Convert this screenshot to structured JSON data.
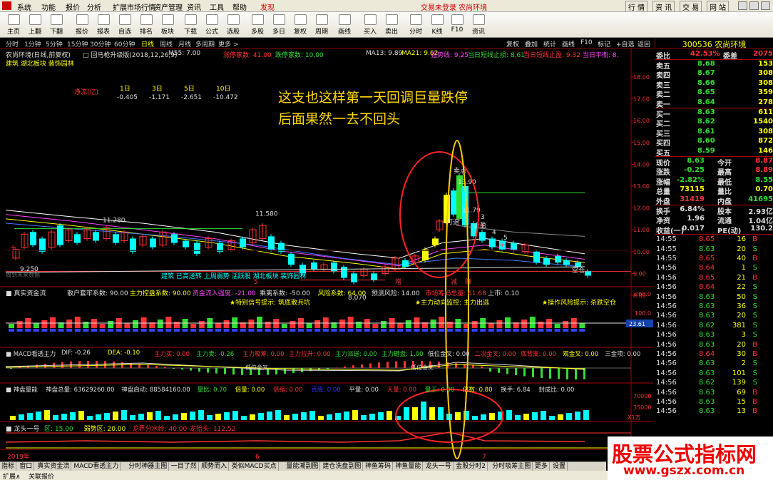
{
  "menu": [
    "系统",
    "功能",
    "报价",
    "分析",
    "扩展市场行情",
    "资产管理",
    "资讯",
    "工具",
    "帮助",
    "发现"
  ],
  "menu_status": "交易未登录  农尚环境",
  "menu_right": [
    "行 情",
    "资 讯",
    "交 易",
    "网 站"
  ],
  "toolbar": [
    {
      "label": "主页",
      "icon": "home-icon"
    },
    {
      "label": "上翻",
      "icon": "up-icon"
    },
    {
      "label": "下翻",
      "icon": "down-icon"
    },
    {
      "label": "报价",
      "icon": "quote-icon"
    },
    {
      "label": "报表",
      "icon": "report-icon"
    },
    {
      "label": "自选",
      "icon": "favorite-icon"
    },
    {
      "label": "排名",
      "icon": "rank-icon"
    },
    {
      "label": "板块",
      "icon": "sector-icon"
    },
    {
      "label": "下载",
      "icon": "download-icon"
    },
    {
      "label": "公式",
      "icon": "formula-icon"
    },
    {
      "label": "选股",
      "icon": "select-icon"
    },
    {
      "label": "多股",
      "icon": "multi-icon"
    },
    {
      "label": "多日",
      "icon": "multiday-icon"
    },
    {
      "label": "复权",
      "icon": "restore-icon"
    },
    {
      "label": "周期",
      "icon": "period-icon"
    },
    {
      "label": "画线",
      "icon": "draw-icon"
    },
    {
      "label": "买入",
      "icon": "buy-icon"
    },
    {
      "label": "卖出",
      "icon": "sell-icon"
    },
    {
      "label": "分时",
      "icon": "minute-icon"
    },
    {
      "label": "K线",
      "icon": "kline-icon"
    },
    {
      "label": "F10",
      "icon": "f10-icon"
    },
    {
      "label": "资讯",
      "icon": "news-icon"
    }
  ],
  "periods": [
    "分时",
    "1分钟",
    "5分钟",
    "15分钟",
    "30分钟",
    "60分钟",
    "日线",
    "周线",
    "月线",
    "多周期",
    "更多 >"
  ],
  "period_right": [
    "复权",
    "叠加",
    "统计",
    "画线",
    "F10",
    "标记",
    "+自选",
    "返回"
  ],
  "stock_code": "300536 农尚环境",
  "header_line1": [
    {
      "t": "农尚环境(日线,前复权)",
      "c": "#ddd"
    },
    {
      "t": "□ 回马枪升级版(2018,12,26,9)",
      "c": "#ddd"
    },
    {
      "t": "M55: 7.00",
      "c": "#ddd"
    },
    {
      "t": "涨停家数: 41.00",
      "c": "#ff3333"
    },
    {
      "t": "跌停家数: 10.00",
      "c": "#33dd33"
    },
    {
      "t": "MA13: 9.89",
      "c": "#ddd"
    },
    {
      "t": "MA21: 9.62",
      "c": "#ffff00"
    },
    {
      "t": "强势线: 9.25",
      "c": "#ff44ff"
    },
    {
      "t": "当日短线止损: 8.61",
      "c": "#33dd33"
    },
    {
      "t": "当日短线止盈: 9.32",
      "c": "#ff3333"
    },
    {
      "t": "当日平衡: 8.",
      "c": "#ff44ff"
    }
  ],
  "header_line2": "建筑 湖北板块 装饰园林",
  "net_flow": {
    "label": "净流(亿)",
    "periods": [
      "1日",
      "3日",
      "5日",
      "10日"
    ],
    "values": [
      "-0.405",
      "-1.171",
      "-2.651",
      "-10.472"
    ]
  },
  "annotation": [
    "这支也这样第一天回调巨量跌停",
    "后面果然一去不回头"
  ],
  "price_axis": [
    "18.00",
    "17.00",
    "16.00",
    "15.00",
    "14.00",
    "13.00",
    "12.00",
    "11.00",
    "10.00",
    "9.00",
    "8.00"
  ],
  "price_labels": {
    "high1": "11.280",
    "high2": "11.580",
    "low1": "9.250",
    "low2": "8.070",
    "peak": "13.90",
    "peak2": "11.79",
    "sell": "卖点",
    "takeprofit": "止盈",
    "ketui": "可退",
    "stoploss": "空仓",
    "num3": "3",
    "num4": "4",
    "num5": "5"
  },
  "sector_text": "建筑 已高送转 上周弱势 活跃股 湖北板块 装饰园林",
  "date_marks": [
    "5",
    "增",
    "减",
    "赚",
    "7"
  ],
  "chart_left_note": "周到末来数据",
  "ind1": {
    "title": "真实资金流",
    "items": [
      {
        "t": "散户套牢系数: 90.00",
        "c": "#ddd"
      },
      {
        "t": "主力控盘系数: 90.00",
        "c": "#ffff00"
      },
      {
        "t": "资金流入强度: -21.00",
        "c": "#ff44ff"
      },
      {
        "t": "乘离系数: -50.00",
        "c": "#ddd"
      },
      {
        "t": "风险系数: 64.00",
        "c": "#ffff00"
      },
      {
        "t": "预测风险: 14.00",
        "c": "#ddd"
      },
      {
        "t": "市场筹码总量: 61.68",
        "c": "#ff3333"
      },
      {
        "t": "上市: 0.10",
        "c": "#ddd"
      }
    ],
    "notes": [
      "★特别信号提示: 筑底散兵坑",
      "★主力动向监控: 主力出逃",
      "★操作风险提示: 杀跌空仓"
    ],
    "axis": [
      "200.0",
      "100.0",
      "23.61"
    ]
  },
  "ind2": {
    "title": "MACD看透主力",
    "items": [
      {
        "t": "DIF: -0.26",
        "c": "#ddd"
      },
      {
        "t": "DEA: -0.10",
        "c": "#ffff00"
      },
      {
        "t": "主力买: 0.00",
        "c": "#ff3333"
      },
      {
        "t": "主力卖: -0.26",
        "c": "#33dd33"
      },
      {
        "t": "主力吸筹: 0.00",
        "c": "#ff3333"
      },
      {
        "t": "主力拉升: 0.00",
        "c": "#ff3333"
      },
      {
        "t": "主力派送: 0.00",
        "c": "#33dd33"
      },
      {
        "t": "主力砸盘: 1.00",
        "c": "#33dd33"
      },
      {
        "t": "低位金叉: 0.00",
        "c": "#ddd"
      },
      {
        "t": "二次金叉: 0.00",
        "c": "#ff3333"
      },
      {
        "t": "底背离: 0.00",
        "c": "#ff3333"
      },
      {
        "t": "观金叉: 0.00",
        "c": "#ffff00"
      },
      {
        "t": "三金项: 0.00",
        "c": "#ddd"
      }
    ],
    "marks": [
      "低位金叉",
      "低位金叉"
    ]
  },
  "ind3": {
    "title": "神盘量能",
    "items": [
      {
        "t": "神盘总量: 63629260.00",
        "c": "#ddd"
      },
      {
        "t": "神盘启动: 88584160.00",
        "c": "#ddd"
      },
      {
        "t": "量比: 0.70",
        "c": "#33dd33"
      },
      {
        "t": "倍量: 0.00",
        "c": "#ffff00"
      },
      {
        "t": "倍缩: 0.00",
        "c": "#ff3333"
      },
      {
        "t": "百底: 0.00",
        "c": "#3333ff"
      },
      {
        "t": "平量: 0.00",
        "c": "#ddd"
      },
      {
        "t": "天量: 0.00",
        "c": "#ff3333"
      },
      {
        "t": "量王: 0.00",
        "c": "#33dd33"
      },
      {
        "t": "倍数: 0.80",
        "c": "#ffff00"
      },
      {
        "t": "换手: 6.84",
        "c": "#ddd"
      },
      {
        "t": "封成比: 0.00",
        "c": "#ddd"
      }
    ],
    "axis": [
      "70000",
      "35000",
      "X1万"
    ]
  },
  "ind4": {
    "title": "龙头一号",
    "items": [
      {
        "t": "区: 15.00",
        "c": "#33dd33"
      },
      {
        "t": "弱势区: 20.00",
        "c": "#ffff00"
      },
      {
        "t": "龙界分水岭: 40.00",
        "c": "#ff3333"
      },
      {
        "t": "龙抬头: 112.52",
        "c": "#ff3333"
      }
    ]
  },
  "timeline": [
    "2019年",
    "6",
    "7"
  ],
  "quote": {
    "weibi_label": "委比",
    "weibi": "42.53%",
    "weicha_label": "委差",
    "weicha": "2075",
    "sells": [
      {
        "l": "卖五",
        "p": "8.68",
        "v": "153"
      },
      {
        "l": "卖四",
        "p": "8.67",
        "v": "308"
      },
      {
        "l": "卖三",
        "p": "8.66",
        "v": "308"
      },
      {
        "l": "卖二",
        "p": "8.65",
        "v": "359"
      },
      {
        "l": "卖一",
        "p": "8.64",
        "v": "278"
      }
    ],
    "buys": [
      {
        "l": "买一",
        "p": "8.63",
        "v": "611"
      },
      {
        "l": "买二",
        "p": "8.62",
        "v": "1540"
      },
      {
        "l": "买三",
        "p": "8.61",
        "v": "308"
      },
      {
        "l": "买四",
        "p": "8.60",
        "v": "872"
      },
      {
        "l": "买五",
        "p": "8.59",
        "v": "146"
      }
    ],
    "stats": [
      {
        "l1": "现价",
        "v1": "8.63",
        "c1": "#33dd33",
        "l2": "今开",
        "v2": "8.87",
        "c2": "#ff3333"
      },
      {
        "l1": "涨跌",
        "v1": "-0.25",
        "c1": "#33dd33",
        "l2": "最高",
        "v2": "8.89",
        "c2": "#ff3333"
      },
      {
        "l1": "涨幅",
        "v1": "-2.82%",
        "c1": "#33dd33",
        "l2": "最低",
        "v2": "8.55",
        "c2": "#33dd33"
      },
      {
        "l1": "总量",
        "v1": "73115",
        "c1": "#ffff00",
        "l2": "量比",
        "v2": "0.70",
        "c2": "#ffff00"
      },
      {
        "l1": "外盘",
        "v1": "31419",
        "c1": "#ff3333",
        "l2": "内盘",
        "v2": "41695",
        "c2": "#33dd33"
      },
      {
        "l1": "换手",
        "v1": "6.84%",
        "c1": "#ddd",
        "l2": "股本",
        "v2": "2.93亿",
        "c2": "#ddd"
      },
      {
        "l1": "净资",
        "v1": "1.96",
        "c1": "#ddd",
        "l2": "流通",
        "v2": "1.04亿",
        "c2": "#ddd"
      },
      {
        "l1": "收益(一)",
        "v1": "0.017",
        "c1": "#ddd",
        "l2": "PE(动)",
        "v2": "130.2",
        "c2": "#ddd"
      }
    ]
  },
  "ticks": [
    {
      "t": "14:55",
      "p": "8.65",
      "v": "16",
      "d": "B"
    },
    {
      "t": "14:55",
      "p": "8.63",
      "v": "20",
      "d": "S"
    },
    {
      "t": "14:55",
      "p": "8.65",
      "v": "40",
      "d": "B"
    },
    {
      "t": "14:56",
      "p": "8.64",
      "v": "1",
      "d": "S"
    },
    {
      "t": "14:56",
      "p": "8.65",
      "v": "21",
      "d": "B"
    },
    {
      "t": "14:56",
      "p": "8.64",
      "v": "22",
      "d": "S"
    },
    {
      "t": "14:56",
      "p": "8.63",
      "v": "50",
      "d": "S"
    },
    {
      "t": "14:56",
      "p": "8.63",
      "v": "36",
      "d": "S"
    },
    {
      "t": "14:56",
      "p": "8.63",
      "v": "20",
      "d": "S"
    },
    {
      "t": "14:56",
      "p": "8.62",
      "v": "381",
      "d": "S"
    },
    {
      "t": "14:56",
      "p": "8.63",
      "v": "3",
      "d": "S"
    },
    {
      "t": "14:56",
      "p": "8.63",
      "v": "20",
      "d": "B"
    },
    {
      "t": "14:56",
      "p": "8.64",
      "v": "30",
      "d": "B"
    },
    {
      "t": "14:56",
      "p": "8.63",
      "v": "2",
      "d": "S"
    },
    {
      "t": "14:56",
      "p": "8.63",
      "v": "101",
      "d": "S"
    },
    {
      "t": "14:56",
      "p": "8.62",
      "v": "139",
      "d": "S"
    },
    {
      "t": "14:56",
      "p": "8.63",
      "v": "69",
      "d": "B"
    },
    {
      "t": "14:56",
      "p": "8.63",
      "v": "15",
      "d": "B"
    },
    {
      "t": "14:56",
      "p": "8.63",
      "v": "13",
      "d": "B"
    }
  ],
  "bottom_tabs": [
    "指标",
    "窗口",
    "真实资金流",
    "MACD看透主力",
    "分时神器主图",
    "一目了然",
    "顺势而入",
    "类似MACD买点",
    "量能潮副图",
    "建仓洗盘副图",
    "神鱼筹码",
    "神鱼量能",
    "龙头一号",
    "金股分时2",
    "分时吸筹主图",
    "更多",
    "设置"
  ],
  "status": [
    "扩展∧",
    "关联报价"
  ],
  "watermark": {
    "title": "股票公式指标网",
    "url": "www.gszx.com.cn"
  },
  "colors": {
    "up": "#ff3333",
    "down": "#00ffff",
    "green": "#33dd33",
    "yellow": "#ffff00",
    "magenta": "#ff44ff"
  },
  "chart_data": {
    "type": "candlestick",
    "annotations": [
      "这支也这样第一天回调巨量跌停",
      "后面果然一去不回头"
    ],
    "ylim": [
      8,
      18.5
    ],
    "last_close": 8.63,
    "ma13": 9.89,
    "ma21": 9.62,
    "labeled_points": [
      {
        "label": "9.250",
        "y": 9.25
      },
      {
        "label": "11.280",
        "y": 11.28
      },
      {
        "label": "11.580",
        "y": 11.58
      },
      {
        "label": "8.070",
        "y": 8.07
      },
      {
        "label": "13.90",
        "y": 13.9
      },
      {
        "label": "11.79",
        "y": 11.79
      }
    ]
  }
}
